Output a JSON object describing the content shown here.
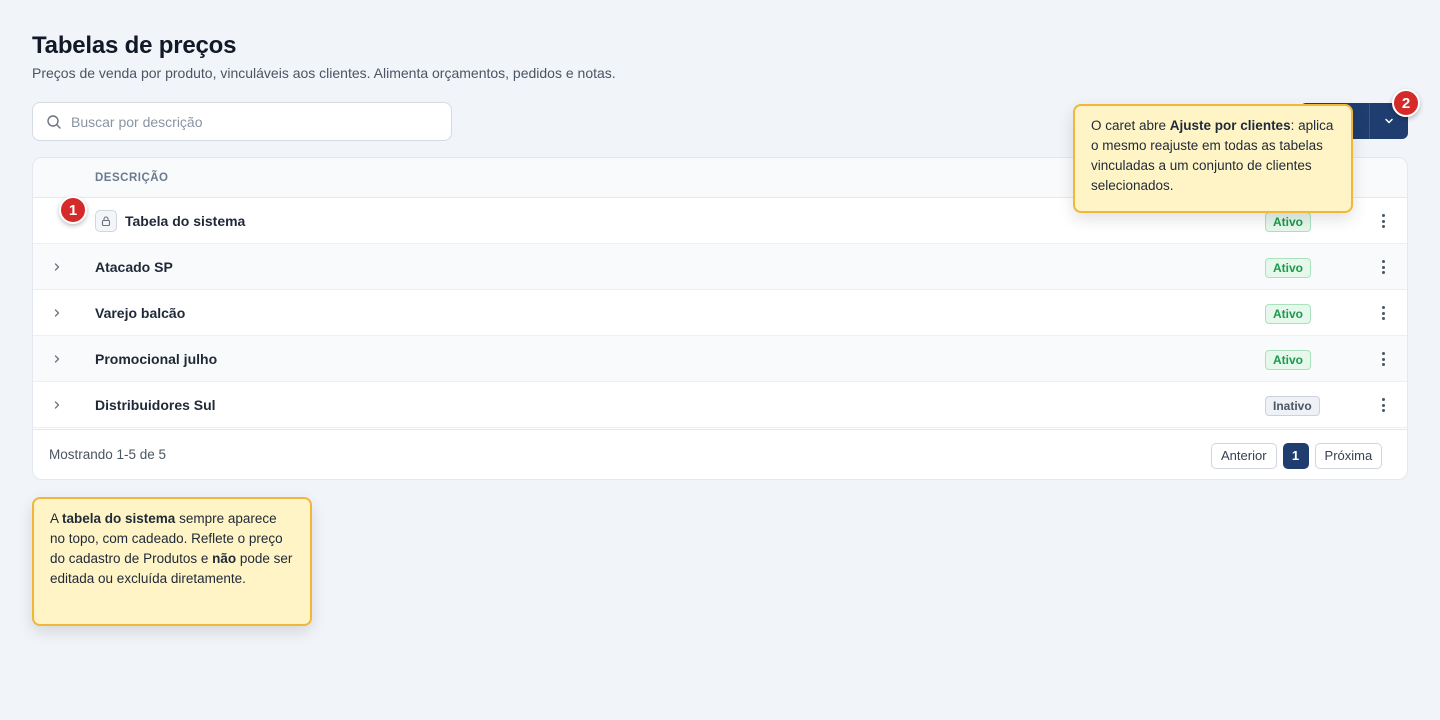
{
  "header": {
    "title": "Tabelas de preços",
    "subtitle": "Preços de venda por produto, vinculáveis aos clientes. Alimenta orçamentos, pedidos e notas."
  },
  "search": {
    "placeholder": "Buscar por descrição",
    "value": ""
  },
  "table": {
    "column_header": "DESCRIÇÃO",
    "rows": [
      {
        "name": "Tabela do sistema",
        "status": "Ativo",
        "locked": true
      },
      {
        "name": "Atacado SP",
        "status": "Ativo",
        "locked": false
      },
      {
        "name": "Varejo balcão",
        "status": "Ativo",
        "locked": false
      },
      {
        "name": "Promocional julho",
        "status": "Ativo",
        "locked": false
      },
      {
        "name": "Distribuidores Sul",
        "status": "Inativo",
        "locked": false
      }
    ]
  },
  "footer": {
    "showing": "Mostrando 1-5 de 5",
    "prev": "Anterior",
    "current_page": "1",
    "next": "Próxima"
  },
  "annotations": {
    "marker1": "1",
    "marker2": "2",
    "tip1": {
      "t1": "A ",
      "b1": "tabela do sistema",
      "t2": " sempre aparece no topo, com cadeado. Reflete o preço do cadastro de Produtos e ",
      "b2": "não",
      "t3": " pode ser editada ou excluída diretamente."
    },
    "tip2": {
      "t1": "O caret abre ",
      "b1": "Ajuste por clientes",
      "t2": ": aplica o mesmo reajuste em todas as tabelas vinculadas a um conjunto de clientes selecionados."
    }
  },
  "colors": {
    "primary": "#1f3d6e",
    "active_badge": "#1b9a4a",
    "marker": "#d42a2a",
    "tip_bg": "#fff4c6",
    "tip_border": "#f2b63a"
  },
  "icons": [
    "search-icon",
    "lock-icon",
    "chevron-right-icon",
    "chevron-down-icon",
    "kebab-icon"
  ]
}
